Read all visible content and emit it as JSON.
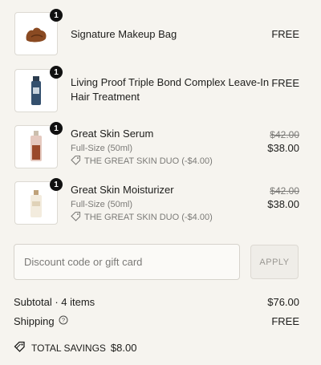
{
  "items": [
    {
      "qty": "1",
      "name": "Signature Makeup Bag",
      "price": "FREE"
    },
    {
      "qty": "1",
      "name": "Living Proof Triple Bond Complex Leave-In Hair Treatment",
      "price": "FREE"
    },
    {
      "qty": "1",
      "name": "Great Skin Serum",
      "variant": "Full-Size (50ml)",
      "discount": "THE GREAT SKIN DUO (-$4.00)",
      "original_price": "$42.00",
      "price": "$38.00"
    },
    {
      "qty": "1",
      "name": "Great Skin Moisturizer",
      "variant": "Full-Size (50ml)",
      "discount": "THE GREAT SKIN DUO (-$4.00)",
      "original_price": "$42.00",
      "price": "$38.00"
    }
  ],
  "discount": {
    "placeholder": "Discount code or gift card",
    "apply_label": "APPLY"
  },
  "totals": {
    "subtotal_label": "Subtotal · 4 items",
    "subtotal_value": "$76.00",
    "shipping_label": "Shipping",
    "shipping_value": "FREE",
    "savings_label": "TOTAL SAVINGS",
    "savings_value": "$8.00"
  }
}
